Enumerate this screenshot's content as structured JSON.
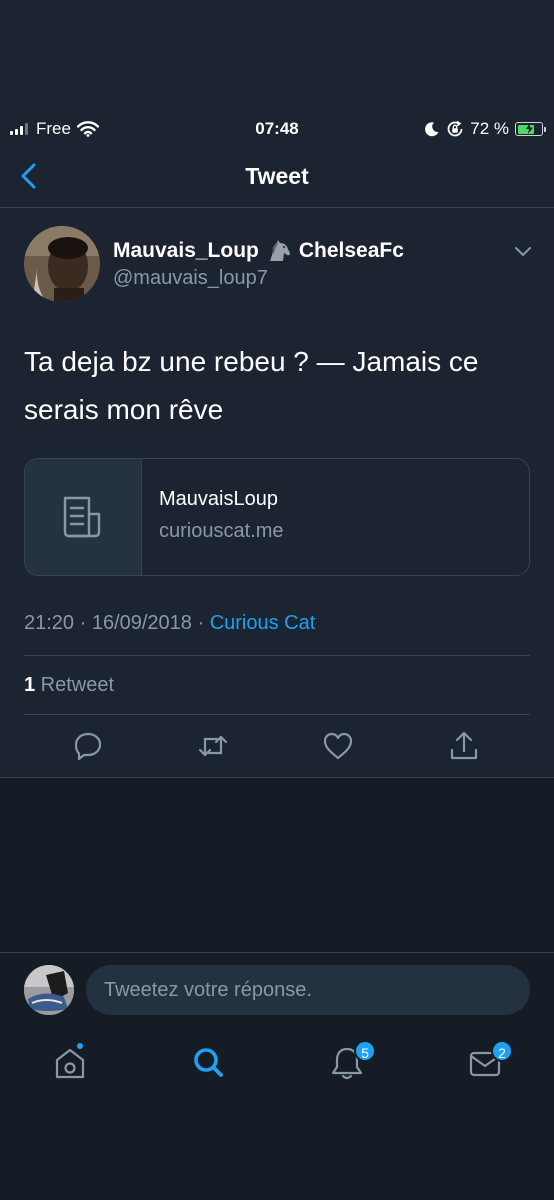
{
  "status_bar": {
    "carrier": "Free",
    "time": "07:48",
    "battery": "72 %"
  },
  "nav": {
    "title": "Tweet"
  },
  "tweet": {
    "display_name": "Mauvais_Loup",
    "name_suffix": "ChelseaFc",
    "handle": "@mauvais_loup7",
    "text_line1": "Ta deja bz une rebeu ? — Jamais ce",
    "text_line2": "serais mon rêve",
    "card": {
      "title": "MauvaisLoup",
      "domain": "curiouscat.me"
    },
    "timestamp": "21:20 · 16/09/2018 · ",
    "source": "Curious Cat",
    "retweet_count": "1",
    "retweet_label": " Retweet"
  },
  "reply": {
    "placeholder": "Tweetez votre réponse."
  },
  "tabs": {
    "notifications_badge": "5",
    "messages_badge": "2"
  },
  "colors": {
    "accent": "#1da1f2",
    "background": "#1b2430",
    "secondary_text": "#8899a6",
    "battery": "#4cd964"
  }
}
